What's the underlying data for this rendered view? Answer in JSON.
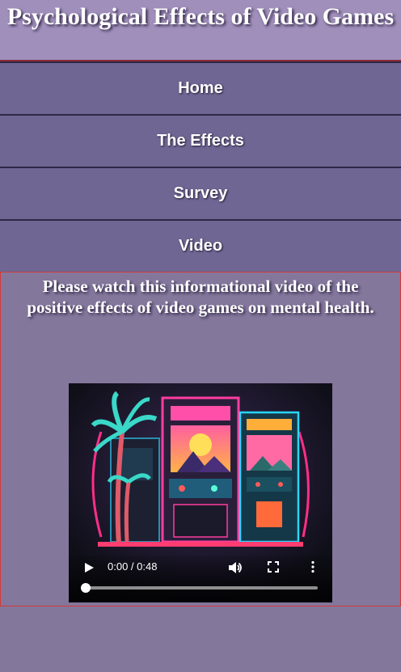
{
  "header": {
    "title": "Psychological Effects of Video Games"
  },
  "nav": {
    "items": [
      {
        "label": "Home"
      },
      {
        "label": "The Effects"
      },
      {
        "label": "Survey"
      },
      {
        "label": "Video"
      }
    ]
  },
  "main": {
    "intro_text": "Please watch this informational video of the positive effects of video games on mental health."
  },
  "video": {
    "time_display": "0:00 / 0:48",
    "progress": 0,
    "icons": {
      "play": "play-icon",
      "volume": "volume-icon",
      "fullscreen": "fullscreen-icon",
      "more": "more-options-icon"
    }
  },
  "colors": {
    "header_bg": "#a08fbb",
    "nav_bg": "#6f6693",
    "page_bg": "#84779c",
    "border_accent": "#d43a3a"
  }
}
